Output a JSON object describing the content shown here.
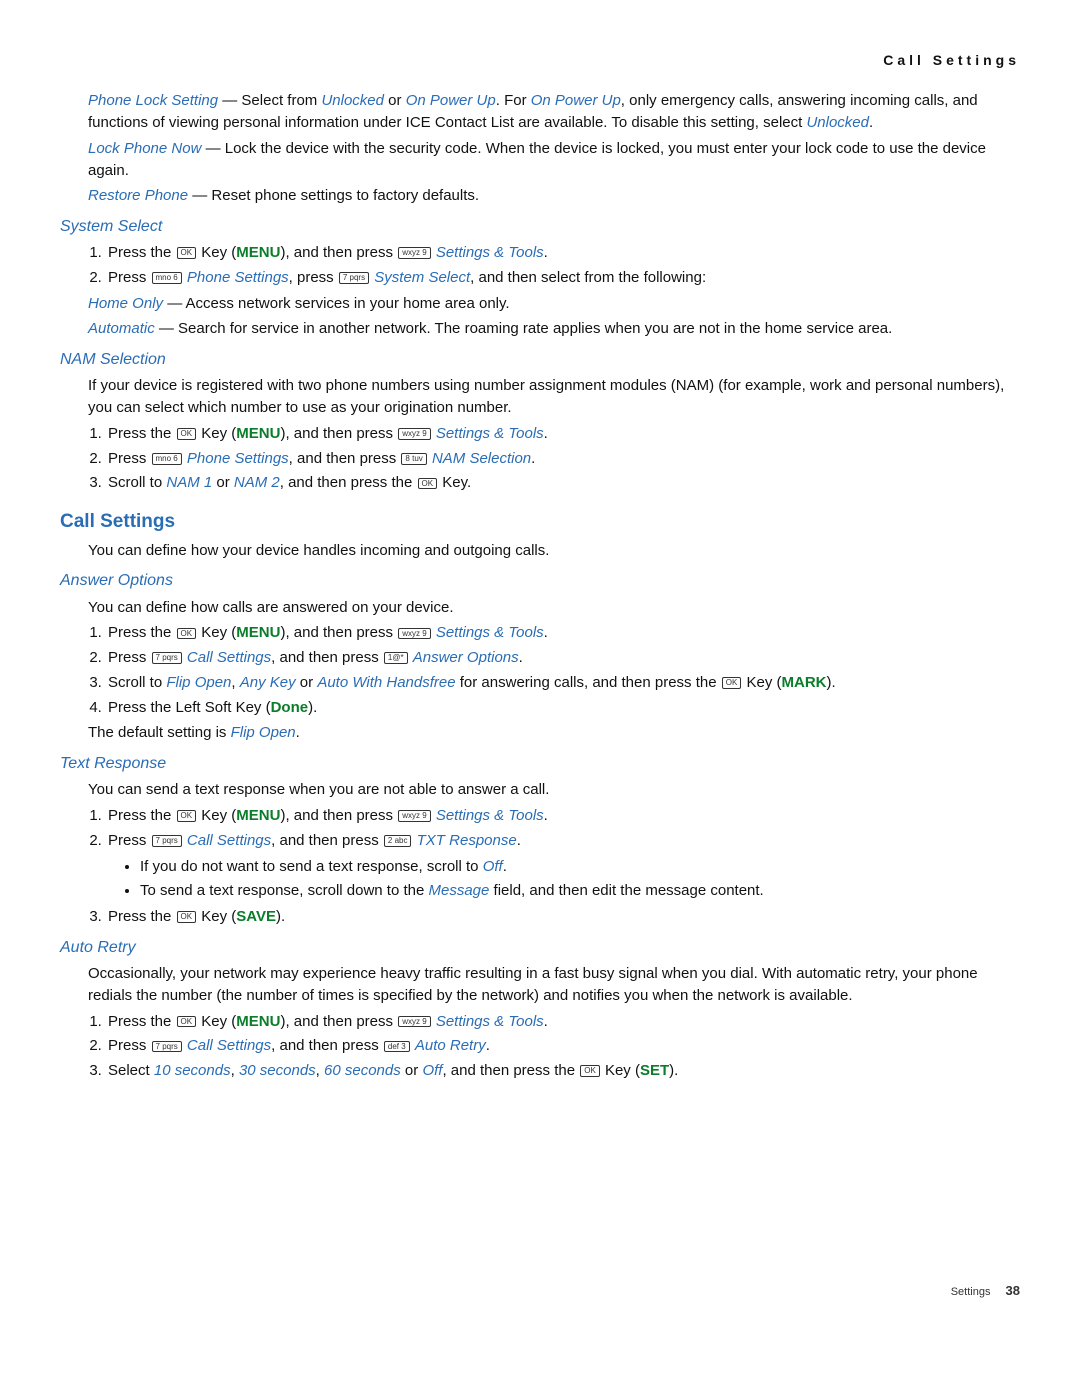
{
  "header": {
    "title": "Call Settings"
  },
  "phone_lock": {
    "setting": "Phone Lock Setting",
    "dash": " — Select from ",
    "unlocked": "Unlocked",
    "or": " or ",
    "on_power_up": "On Power Up",
    "for": ". For ",
    "on_power_up2": "On Power Up",
    "cont1": ", only emergency calls, answering incoming calls, and functions of viewing personal information under ICE Contact List are available. To disable this setting, select ",
    "unlocked2": "Unlocked",
    "period": "."
  },
  "lock_now": {
    "title": "Lock Phone Now",
    "body": " — Lock the device with the security code. When the device is locked, you must enter your lock code to use the device again."
  },
  "restore": {
    "title": "Restore Phone",
    "body": " — Reset phone settings to factory defaults."
  },
  "system_select": {
    "heading": "System Select",
    "step1_a": "Press the ",
    "step1_b": " Key (",
    "menu": "MENU",
    "step1_c": "), and then press ",
    "settings_tools": "Settings & Tools",
    "period": ".",
    "step2_a": "Press ",
    "phone_settings": "Phone Settings",
    "step2_b": ", press ",
    "system_select_link": "System Select",
    "step2_c": ", and then select from the following:",
    "home_only": "Home Only",
    "home_body": " — Access network services in your home area only.",
    "automatic": "Automatic",
    "auto_body": " — Search for service in another network. The roaming rate applies when you are not in the home service area."
  },
  "nam": {
    "heading": "NAM Selection",
    "intro": "If your device is registered with two phone numbers using number assignment modules (NAM) (for example, work and personal numbers), you can select which number to use as your origination number.",
    "step1_a": "Press the ",
    "step1_b": " Key (",
    "menu": "MENU",
    "step1_c": "), and then press ",
    "settings_tools": "Settings & Tools",
    "period": ".",
    "step2_a": "Press ",
    "phone_settings": "Phone Settings",
    "step2_b": ", and then press ",
    "nam_selection": "NAM Selection",
    "step3_a": "Scroll to ",
    "nam1": "NAM 1",
    "or": " or ",
    "nam2": "NAM 2",
    "step3_b": ", and then press the ",
    "step3_c": " Key."
  },
  "call_settings": {
    "heading": "Call Settings",
    "intro": "You can define how your device handles incoming and outgoing calls."
  },
  "answer": {
    "heading": "Answer Options",
    "intro": "You can define how calls are answered on your device.",
    "step1_a": "Press the ",
    "step1_b": " Key (",
    "menu": "MENU",
    "step1_c": "), and then press ",
    "settings_tools": "Settings & Tools",
    "period": ".",
    "step2_a": "Press ",
    "call_settings": "Call Settings",
    "step2_b": ", and then press ",
    "answer_options": "Answer Options",
    "step3_a": "Scroll to ",
    "flip_open": "Flip Open",
    "comma": ", ",
    "any_key": "Any Key",
    "or": " or ",
    "auto_handsfree": "Auto With Handsfree",
    "step3_b": " for answering calls, and then press the ",
    "step3_c": " Key (",
    "mark": "MARK",
    "step3_d": ").",
    "step4_a": "Press the Left Soft Key (",
    "done": "Done",
    "step4_b": ").",
    "default_a": "The default setting is ",
    "default_b": "Flip Open"
  },
  "text_resp": {
    "heading": "Text Response",
    "intro": "You can send a text response when you are not able to answer a call.",
    "step1_a": "Press the ",
    "step1_b": " Key (",
    "menu": "MENU",
    "step1_c": "), and then press ",
    "settings_tools": "Settings & Tools",
    "period": ".",
    "step2_a": "Press ",
    "call_settings": "Call Settings",
    "step2_b": ", and then press ",
    "txt_response": "TXT Response",
    "bullet1_a": "If you do not want to send a text response, scroll to ",
    "off": "Off",
    "bullet2_a": "To send a text response, scroll down to the ",
    "message": "Message",
    "bullet2_b": " field, and then edit the message content.",
    "step3_a": "Press the ",
    "step3_b": " Key (",
    "save": "SAVE",
    "step3_c": ")."
  },
  "auto_retry": {
    "heading": "Auto Retry",
    "intro": "Occasionally, your network may experience heavy traffic resulting in a fast busy signal when you dial. With automatic retry, your phone redials the number (the number of times is specified by the network) and notifies you when the network is available.",
    "step1_a": "Press the ",
    "step1_b": " Key (",
    "menu": "MENU",
    "step1_c": "), and then press ",
    "settings_tools": "Settings & Tools",
    "period": ".",
    "step2_a": "Press ",
    "call_settings": "Call Settings",
    "step2_b": ", and then press ",
    "auto_retry_link": "Auto Retry",
    "step3_a": "Select ",
    "t10": "10 seconds",
    "comma": ", ",
    "t30": "30 seconds",
    "t60": "60 seconds",
    "or": " or ",
    "off": "Off",
    "step3_b": ", and then press the ",
    "step3_c": " Key (",
    "set": "SET",
    "step3_d": ")."
  },
  "keys": {
    "ok": "OK",
    "wxyz9": "wxyz 9",
    "mno6": "mno 6",
    "pqrs7": "7 pqrs",
    "tuv8": "8 tuv",
    "at1": "1@*",
    "abc2": "2 abc",
    "def3": "def 3"
  },
  "footer": {
    "section": "Settings",
    "page": "38"
  }
}
